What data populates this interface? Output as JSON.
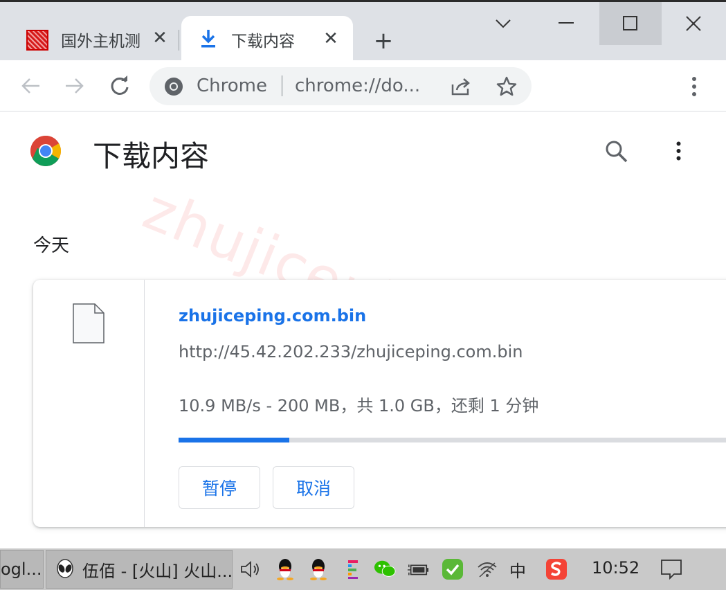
{
  "tabs": [
    {
      "title": "国外主机测",
      "active": false,
      "icon": "site-favicon"
    },
    {
      "title": "下载内容",
      "active": true,
      "icon": "download-icon"
    }
  ],
  "toolbar": {
    "chip_label": "Chrome",
    "url": "chrome://do..."
  },
  "page": {
    "title": "下载内容",
    "date_group": "今天"
  },
  "download": {
    "file_name": "zhujiceping.com.bin",
    "url": "http://45.42.202.233/zhujiceping.com.bin",
    "status": "10.9 MB/s - 200 MB，共 1.0 GB，还剩 1 分钟",
    "progress_fraction": 0.2,
    "pause_label": "暂停",
    "cancel_label": "取消"
  },
  "watermark": "zhujiceping.com",
  "taskbar": {
    "item1": "ogl...",
    "item2": "伍佰 - [火山] 火山...",
    "ime": "中",
    "clock": "10:52"
  },
  "colors": {
    "accent": "#1a73e8",
    "tabstrip": "#dee1e6",
    "taskbar": "#c9c9c9"
  }
}
